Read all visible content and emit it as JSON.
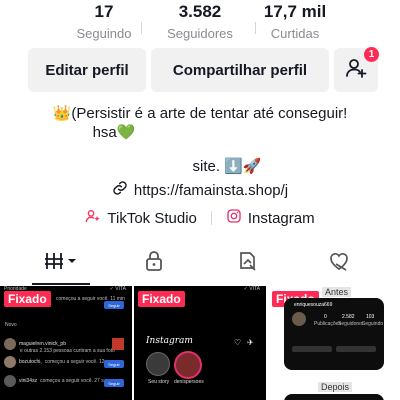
{
  "stats": [
    {
      "value": "17",
      "label": "Seguindo"
    },
    {
      "value": "3.582",
      "label": "Seguidores"
    },
    {
      "value": "17,7 mil",
      "label": "Curtidas"
    }
  ],
  "buttons": {
    "edit_profile": "Editar perfil",
    "share_profile": "Compartilhar perfil",
    "add_friends_badge": "1"
  },
  "bio": {
    "line1": "👑(Persistir é a arte de tentar até conseguir!",
    "line2": "hsa💚",
    "line3": "site. ⬇️🚀"
  },
  "link": {
    "text": "https://famainsta.shop/j",
    "icon": "link-icon"
  },
  "apps": [
    {
      "label": "TikTok Studio",
      "icon": "tiktok-studio-icon",
      "color": "#fe2c55"
    },
    {
      "label": "Instagram",
      "icon": "instagram-icon",
      "color": "#e1306c"
    }
  ],
  "tabs": [
    {
      "icon": "videos-grid-icon",
      "active": true
    },
    {
      "icon": "lock-icon",
      "active": false
    },
    {
      "icon": "repost-icon",
      "active": false
    },
    {
      "icon": "liked-icon",
      "active": false
    }
  ],
  "videos": [
    {
      "pinned_label": "Fixado",
      "overlay": {
        "brand": "✓ VITA",
        "section1": "Prioridade",
        "row1": "começou a seguir você. 11 min",
        "follow": "Seguir",
        "section2": "Novo",
        "row2_user": "maguielren.vinick_pb",
        "row2": "e outras 2.153 pessoas curtiram a sua foto",
        "row3_user": "bozutochi,",
        "row3": "começou a seguir você. 12 s",
        "row4_user": "vini34sz",
        "row4": "começou a seguir você. 27 s"
      }
    },
    {
      "pinned_label": "Fixado",
      "overlay": {
        "brand": "✓ VITA",
        "app": "Instagram",
        "story1": "Seu story",
        "story2": "denispersoes"
      }
    },
    {
      "pinned_label": "Fixado",
      "overlay": {
        "before": "Antes",
        "after": "Depois",
        "username": "enriquesouza669",
        "posts": "0",
        "followers": "2.582",
        "following": "103",
        "posts_label": "Publicações",
        "followers_label": "Seguidores",
        "following_label": "Seguindo"
      }
    }
  ]
}
